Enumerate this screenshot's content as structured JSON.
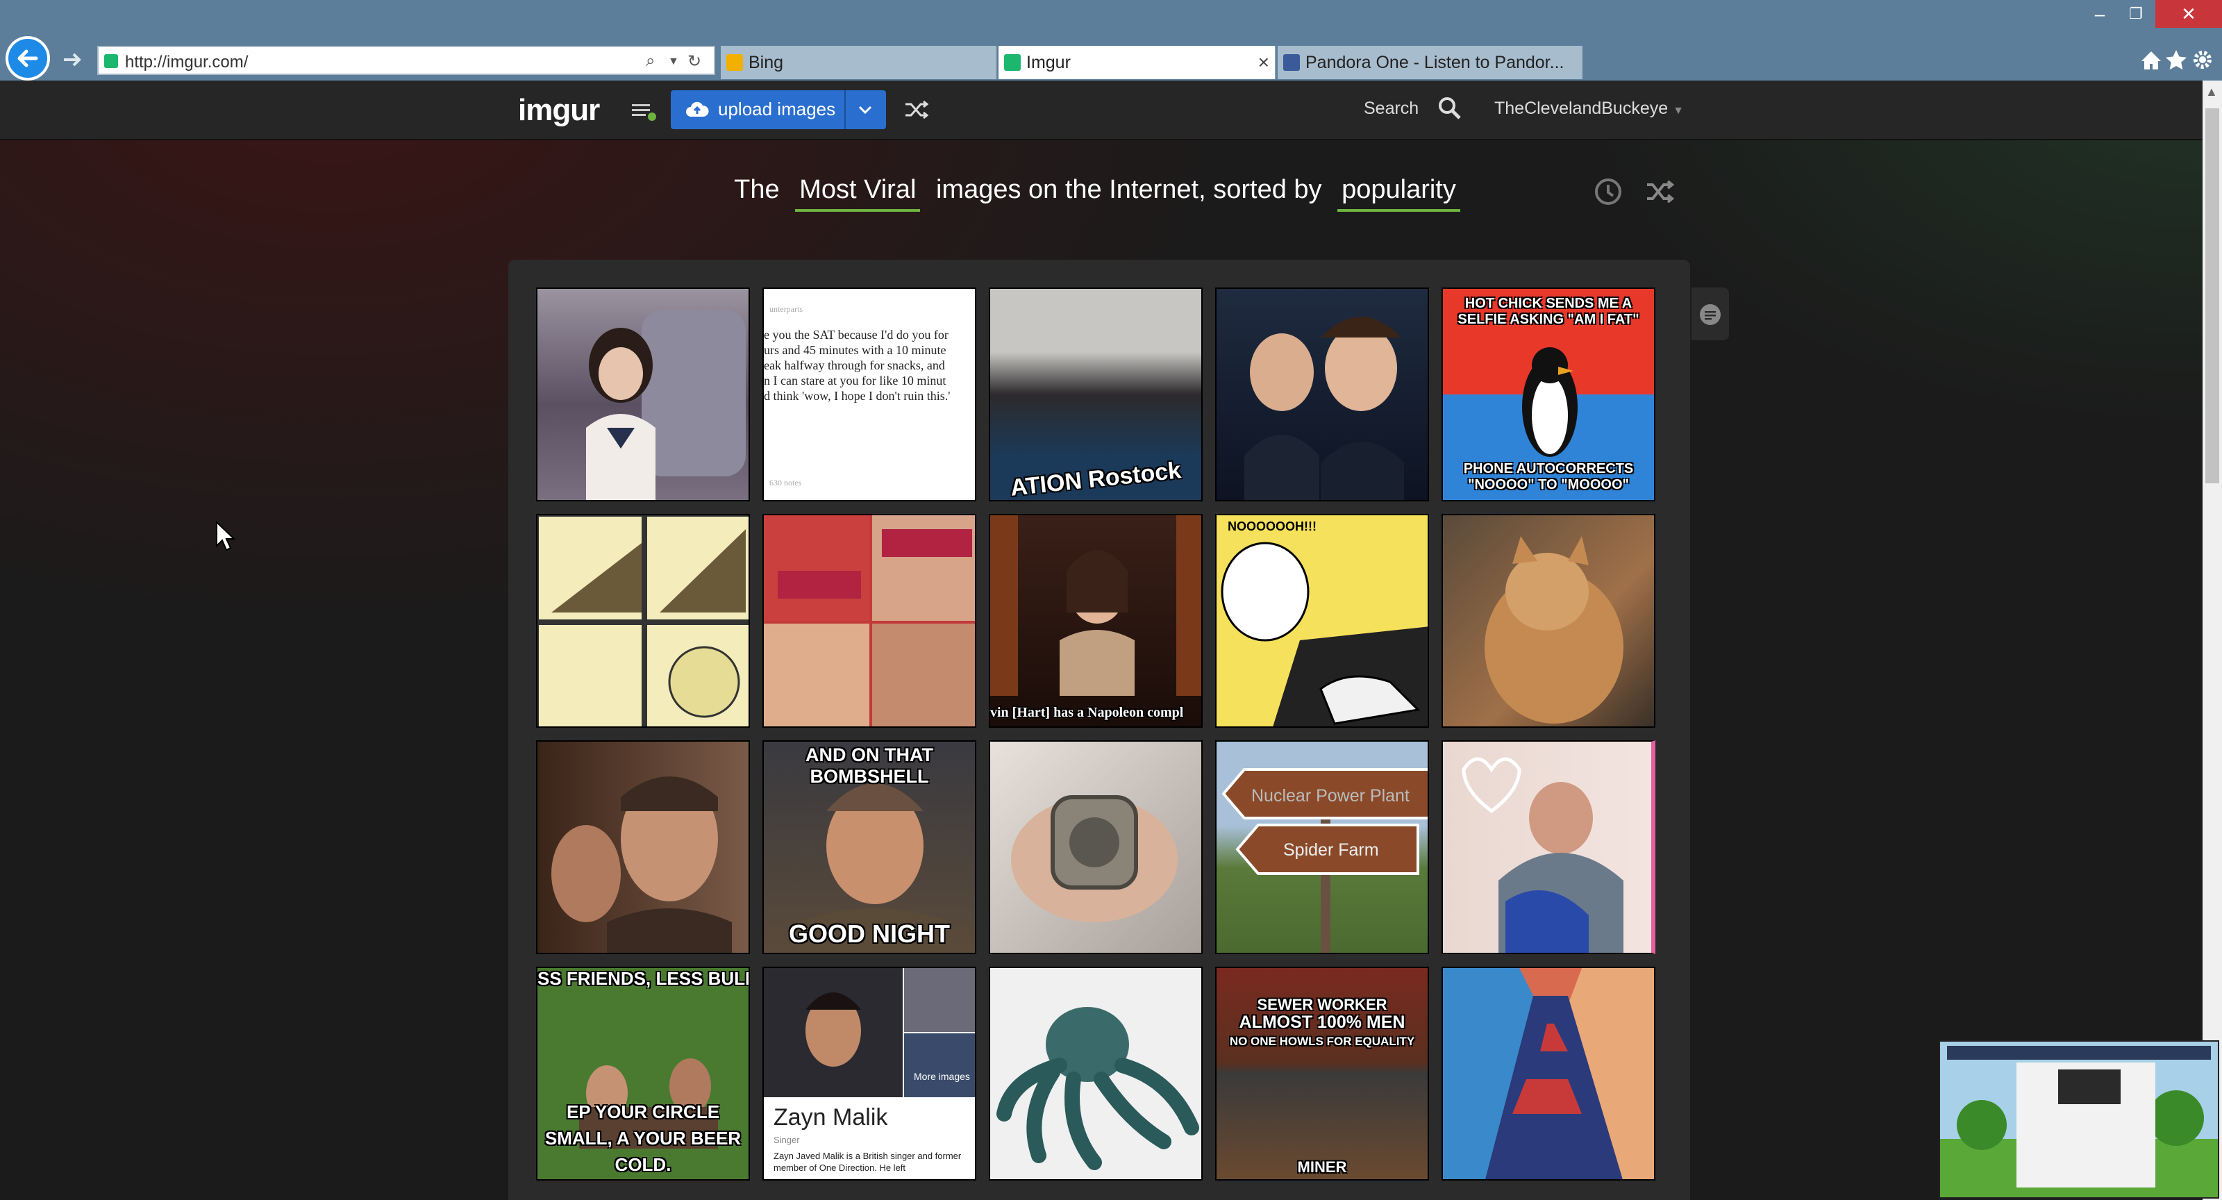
{
  "browser": {
    "address": "http://imgur.com/",
    "tabs": [
      {
        "label": "Bing",
        "favicon_color": "#f2b100"
      },
      {
        "label": "Imgur",
        "favicon_color": "#1bb76e",
        "active": true
      },
      {
        "label": "Pandora One - Listen to Pandor...",
        "favicon_color": "#3a5a9a"
      }
    ],
    "window_controls": {
      "minimize": "–",
      "restore": "❐",
      "close": "✕"
    }
  },
  "header": {
    "logo": "imgur",
    "upload_label": "upload images",
    "search_label": "Search",
    "username": "TheClevelandBuckeye"
  },
  "headline": {
    "prefix": "The",
    "section": "Most Viral",
    "middle": "images on the Internet, sorted by",
    "sort": "popularity"
  },
  "gallery": {
    "captions": {
      "meme_top": "HOT CHICK SENDS ME A SELFIE ASKING \"AM I FAT\"",
      "meme_bottom": "PHONE AUTOCORRECTS \"NOOOO\" TO \"MOOOO\"",
      "tumblr_line1": "e you the SAT because I'd do you for",
      "tumblr_line2": "urs and 45 minutes with a 10 minute",
      "tumblr_line3": "eak halfway through for snacks, and",
      "tumblr_line4": "n I can stare at you for like 10 minut",
      "tumblr_line5": "d think 'wow, I hope I don't ruin this.'",
      "tumblr_source": "unterparts",
      "tumblr_notes": "630 notes",
      "rowing_sign": "ATION Rostock",
      "comic_shout": "NOOOOOOH!!!",
      "kevin_caption": "vin [Hart] has a Napoleon compl",
      "bombshell_top": "AND ON THAT BOMBSHELL",
      "bombshell_bottom": "GOOD NIGHT",
      "sign_top": "Nuclear Power Plant",
      "sign_bottom": "Spider Farm",
      "friends_top": "SS FRIENDS, LESS BULLSH",
      "friends_bottom": "EP YOUR CIRCLE SMALL, A YOUR BEER COLD.",
      "zayn_name": "Zayn Malik",
      "zayn_role": "Singer",
      "zayn_desc": "Zayn Javed Malik is a British singer and former member of One Direction. He left",
      "zayn_more": "More images",
      "sewer_top": "SEWER WORKER",
      "sewer_mid": "ALMOST 100% MEN",
      "sewer_sub": "NO ONE HOWLS FOR EQUALITY",
      "miner": "MINER"
    }
  },
  "colors": {
    "accent_green": "#6eb33f",
    "upload_blue": "#2a6fcf",
    "titlebar": "#5c7e9a"
  }
}
